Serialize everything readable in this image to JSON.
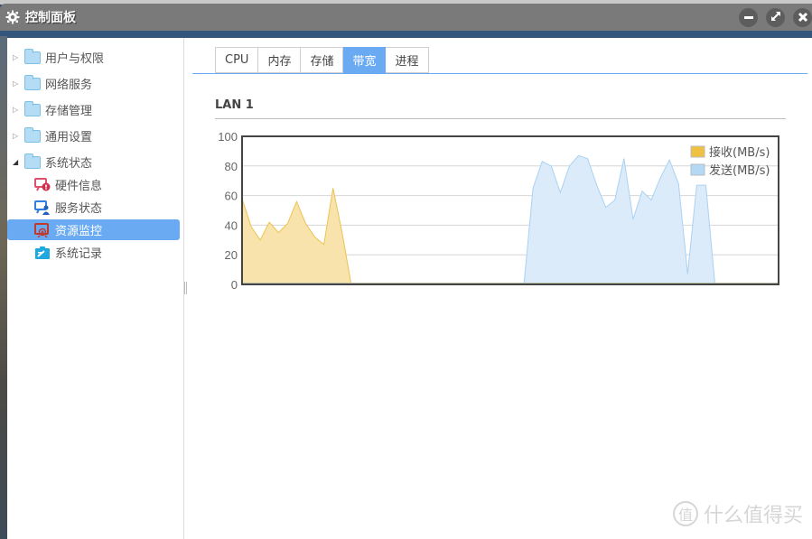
{
  "window": {
    "title": "控制面板",
    "title_icon": "gear-icon",
    "controls": [
      {
        "name": "minimize-button",
        "icon": "minus-icon"
      },
      {
        "name": "maximize-button",
        "icon": "expand-icon"
      },
      {
        "name": "close-button",
        "icon": "close-icon"
      }
    ]
  },
  "sidebar": {
    "folders": [
      {
        "label": "用户与权限",
        "expanded": false
      },
      {
        "label": "网络服务",
        "expanded": false
      },
      {
        "label": "存储管理",
        "expanded": false
      },
      {
        "label": "通用设置",
        "expanded": false
      },
      {
        "label": "系统状态",
        "expanded": true
      }
    ],
    "children": [
      {
        "label": "硬件信息",
        "icon": "hardware-info-icon",
        "selected": false
      },
      {
        "label": "服务状态",
        "icon": "service-status-icon",
        "selected": false
      },
      {
        "label": "资源监控",
        "icon": "resource-monitor-icon",
        "selected": true
      },
      {
        "label": "系统记录",
        "icon": "system-log-icon",
        "selected": false
      }
    ]
  },
  "tabs": [
    {
      "label": "CPU",
      "active": false
    },
    {
      "label": "内存",
      "active": false
    },
    {
      "label": "存储",
      "active": false
    },
    {
      "label": "带宽",
      "active": true
    },
    {
      "label": "进程",
      "active": false
    }
  ],
  "colors": {
    "accent": "#6aaaf2",
    "receive": "#f0c040",
    "send": "#b3d9f7"
  },
  "section_title": "LAN 1",
  "watermark": {
    "glyph": "值",
    "text": "什么值得买"
  },
  "chart_data": {
    "type": "area",
    "title": "LAN 1",
    "xlabel": "",
    "ylabel": "",
    "ylim": [
      0,
      100
    ],
    "yticks": [
      0,
      20,
      40,
      60,
      80,
      100
    ],
    "grid": true,
    "legend": "top-right",
    "x": [
      0,
      1,
      2,
      3,
      4,
      5,
      6,
      7,
      8,
      9,
      10,
      11,
      12,
      13,
      14,
      15,
      16,
      17,
      18,
      19,
      20,
      21,
      22,
      23,
      24,
      25,
      26,
      27,
      28,
      29,
      30,
      31,
      32,
      33,
      34,
      35,
      36,
      37,
      38,
      39,
      40,
      41,
      42,
      43,
      44,
      45,
      46,
      47,
      48,
      49,
      50,
      51,
      52,
      53,
      54,
      55,
      56,
      57,
      58,
      59
    ],
    "series": [
      {
        "name": "接收(MB/s)",
        "values": [
          58,
          39,
          30,
          42,
          35,
          41,
          56,
          41,
          32,
          27,
          65,
          35,
          0,
          0,
          0,
          0,
          0,
          0,
          0,
          0,
          0,
          0,
          0,
          0,
          0,
          0,
          0,
          0,
          0,
          0,
          0,
          0,
          0,
          0,
          0,
          0,
          0,
          0,
          0,
          0,
          0,
          0,
          0,
          0,
          0,
          0,
          0,
          0,
          0,
          0,
          0,
          0,
          0,
          0,
          0,
          0,
          0,
          0,
          0,
          0
        ]
      },
      {
        "name": "发送(MB/s)",
        "values": [
          0,
          0,
          0,
          0,
          0,
          0,
          0,
          0,
          0,
          0,
          0,
          0,
          0,
          0,
          0,
          0,
          0,
          0,
          0,
          0,
          0,
          0,
          0,
          0,
          0,
          0,
          0,
          0,
          0,
          0,
          0,
          0,
          65,
          83,
          80,
          62,
          80,
          87,
          85,
          67,
          52,
          57,
          85,
          44,
          63,
          57,
          72,
          84,
          68,
          7,
          67,
          67,
          0,
          0,
          0,
          0,
          0,
          0,
          0,
          0
        ]
      }
    ]
  }
}
